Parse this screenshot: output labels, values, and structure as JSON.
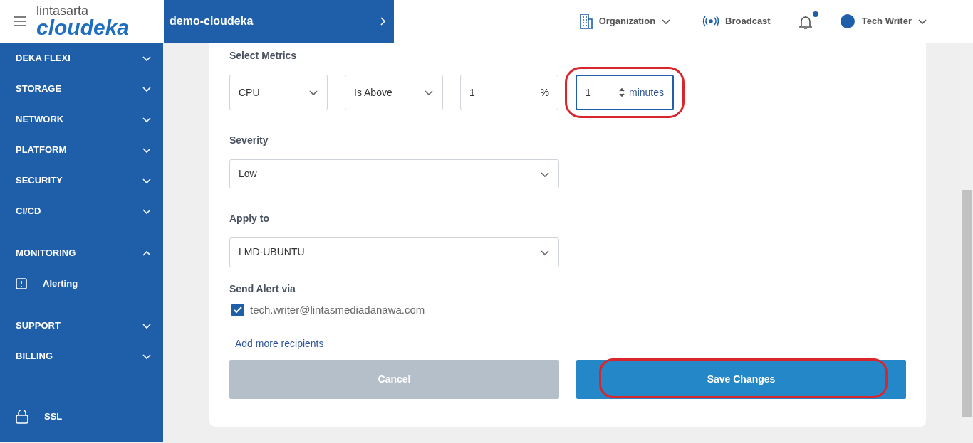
{
  "header": {
    "brand_top": "lintasarta",
    "brand": "cloudeka",
    "project": "demo-cloudeka",
    "nav": [
      {
        "kind": "org",
        "label": "Organization",
        "dropdown": true
      },
      {
        "kind": "broadcast",
        "label": "Broadcast"
      }
    ],
    "notifications": {
      "unread": true
    },
    "user": {
      "name": "Tech Writer",
      "dropdown": true
    }
  },
  "sidebar": {
    "items": [
      {
        "label": "DEKA FLEXI",
        "expanded": false
      },
      {
        "label": "STORAGE",
        "expanded": false
      },
      {
        "label": "NETWORK",
        "expanded": false
      },
      {
        "label": "PLATFORM",
        "expanded": false
      },
      {
        "label": "SECURITY",
        "expanded": false
      },
      {
        "label": "CI/CD",
        "expanded": false
      },
      {
        "label": "MONITORING",
        "expanded": true,
        "children": [
          {
            "label": "Alerting"
          }
        ]
      },
      {
        "label": "SUPPORT",
        "expanded": false
      },
      {
        "label": "BILLING",
        "expanded": false
      }
    ],
    "footer_item": {
      "label": "SSL"
    }
  },
  "form": {
    "metrics": {
      "label": "Select Metrics",
      "metric": "CPU",
      "operator": "Is Above",
      "threshold": "1",
      "threshold_unit": "%",
      "duration": "1",
      "duration_unit": "minutes",
      "duration_highlighted": true,
      "duration_focused": true
    },
    "severity": {
      "label": "Severity",
      "value": "Low"
    },
    "apply_to": {
      "label": "Apply to",
      "value": "LMD-UBUNTU"
    },
    "send_alert": {
      "label": "Send Alert via",
      "recipients": [
        {
          "email": "tech.writer@lintasmediadanawa.com",
          "checked": true
        }
      ],
      "add_link": "Add more recipients"
    },
    "buttons": [
      {
        "kind": "cancel",
        "label": "Cancel",
        "highlighted": false
      },
      {
        "kind": "save",
        "label": "Save Changes",
        "highlighted": true
      }
    ]
  }
}
